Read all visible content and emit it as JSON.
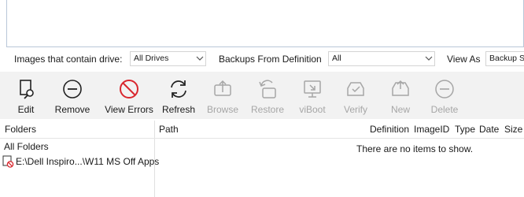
{
  "filters": {
    "drive_label": "Images that contain drive:",
    "drive_value": "All Drives",
    "definition_label": "Backups From Definition",
    "definition_value": "All",
    "view_as_label": "View As",
    "view_as_value": "Backup Se"
  },
  "toolbar": {
    "buttons": [
      {
        "label": "Edit",
        "icon": "edit-icon",
        "enabled": true
      },
      {
        "label": "Remove",
        "icon": "remove-icon",
        "enabled": true
      },
      {
        "label": "View Errors",
        "icon": "no-entry-icon",
        "enabled": true
      },
      {
        "label": "Refresh",
        "icon": "refresh-icon",
        "enabled": true
      },
      {
        "label": "Browse",
        "icon": "browse-icon",
        "enabled": false
      },
      {
        "label": "Restore",
        "icon": "restore-icon",
        "enabled": false
      },
      {
        "label": "viBoot",
        "icon": "viboot-icon",
        "enabled": false
      },
      {
        "label": "Verify",
        "icon": "verify-icon",
        "enabled": false
      },
      {
        "label": "New",
        "icon": "new-icon",
        "enabled": false
      },
      {
        "label": "Delete",
        "icon": "delete-icon",
        "enabled": false
      }
    ]
  },
  "folders": {
    "header": "Folders",
    "root": "All Folders",
    "items": [
      {
        "label": "E:\\Dell Inspiro...\\W11 MS Off Apps",
        "icon": "folder-error-icon"
      }
    ]
  },
  "list": {
    "columns": [
      "Path",
      "Definition",
      "ImageID",
      "Type",
      "Date",
      "Size"
    ],
    "empty_message": "There are no items to show."
  },
  "colors": {
    "toolbar_bg": "#f2f2f2",
    "error_red": "#d9272e",
    "disabled_gray": "#a6a6a6"
  }
}
